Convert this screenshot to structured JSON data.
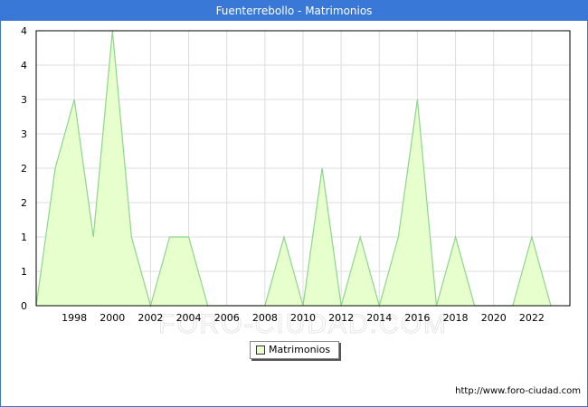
{
  "window": {
    "title": "Fuenterrebollo - Matrimonios"
  },
  "watermark": "FORO-CIUDAD.COM",
  "source": "http://www.foro-ciudad.com",
  "colors": {
    "header": "#3a78d8",
    "fill": "#e6ffcc",
    "line": "#8fd48f",
    "grid": "#dddddd"
  },
  "chart_data": {
    "type": "area",
    "title": "Fuenterrebollo - Matrimonios",
    "xlabel": "",
    "ylabel": "",
    "xlim": [
      1996,
      2024
    ],
    "ylim": [
      0,
      4
    ],
    "x_ticks": [
      1998,
      2000,
      2002,
      2004,
      2006,
      2008,
      2010,
      2012,
      2014,
      2016,
      2018,
      2020,
      2022
    ],
    "y_ticks": [
      0,
      0.5,
      1,
      1.5,
      2,
      2.5,
      3,
      3.5,
      4
    ],
    "y_tick_labels": [
      "0",
      "1",
      "1",
      "2",
      "2",
      "3",
      "3",
      "4",
      "4"
    ],
    "grid": true,
    "legend": "bottom-center",
    "series": [
      {
        "name": "Matrimonios",
        "x": [
          1996,
          1997,
          1998,
          1999,
          2000,
          2001,
          2002,
          2003,
          2004,
          2005,
          2006,
          2007,
          2008,
          2009,
          2010,
          2011,
          2012,
          2013,
          2014,
          2015,
          2016,
          2017,
          2018,
          2019,
          2020,
          2021,
          2022,
          2023
        ],
        "values": [
          0,
          2,
          3,
          1,
          4,
          1,
          0,
          1,
          1,
          0,
          0,
          0,
          0,
          1,
          0,
          2,
          0,
          1,
          0,
          1,
          3,
          0,
          1,
          0,
          0,
          0,
          1,
          0
        ]
      }
    ]
  }
}
